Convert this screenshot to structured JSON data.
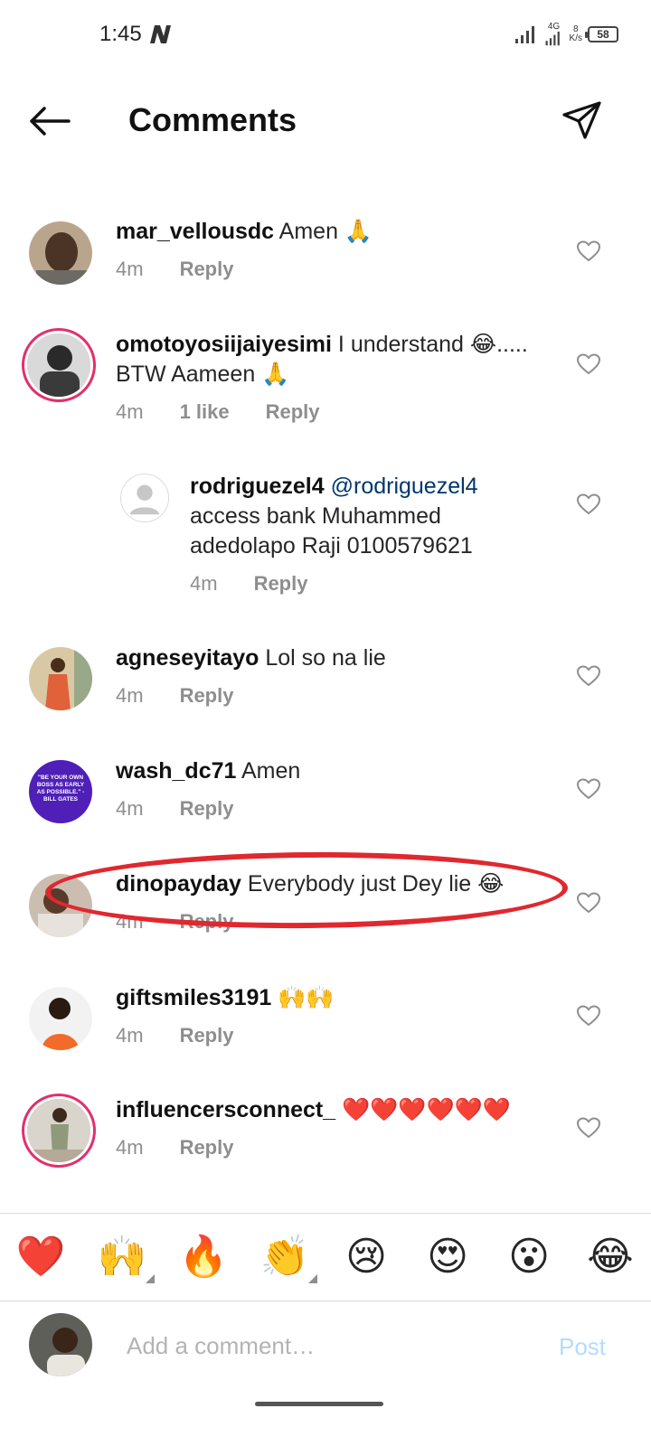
{
  "status_bar": {
    "time": "1:45",
    "network": "4G",
    "speed_value": "8",
    "speed_unit": "K/s",
    "battery": "58"
  },
  "header": {
    "title": "Comments",
    "back_icon": "arrow-left-icon",
    "send_icon": "paper-plane-icon"
  },
  "comments": [
    {
      "username": "mar_vellousdc",
      "text": "Amen 🙏",
      "time": "4m",
      "likes": "",
      "reply_label": "Reply"
    },
    {
      "username": "omotoyosiijaiyesimi",
      "text": "I understand 😂..... BTW Aameen 🙏",
      "time": "4m",
      "likes": "1 like",
      "reply_label": "Reply"
    },
    {
      "username": "rodriguezel4",
      "mention": "@rodriguezel4",
      "text": "access bank Muhammed adedolapo Raji 0100579621",
      "time": "4m",
      "likes": "",
      "reply_label": "Reply"
    },
    {
      "username": "agneseyitayo",
      "text": "Lol so na lie",
      "time": "4m",
      "likes": "",
      "reply_label": "Reply"
    },
    {
      "username": "wash_dc71",
      "text": "Amen",
      "time": "4m",
      "likes": "",
      "reply_label": "Reply",
      "avatar_text": "\"BE YOUR OWN BOSS AS EARLY AS POSSIBLE.\" - BILL GATES"
    },
    {
      "username": "dinopayday",
      "text": "Everybody just Dey lie 😂",
      "time": "4m",
      "likes": "",
      "reply_label": "Reply"
    },
    {
      "username": "giftsmiles3191",
      "text": "🙌🙌",
      "time": "4m",
      "likes": "",
      "reply_label": "Reply"
    },
    {
      "username": "influencersconnect_",
      "text": "❤️❤️❤️❤️❤️❤️",
      "time": "4m",
      "likes": "",
      "reply_label": "Reply"
    }
  ],
  "emoji_bar": [
    "❤️",
    "🙌",
    "🔥",
    "👏",
    "😢",
    "😍",
    "😮",
    "😂"
  ],
  "input": {
    "placeholder": "Add a comment…",
    "post_label": "Post"
  },
  "colors": {
    "accent": "#0095f6",
    "highlight": "#e0282e",
    "story_ring": "#e1306c"
  }
}
